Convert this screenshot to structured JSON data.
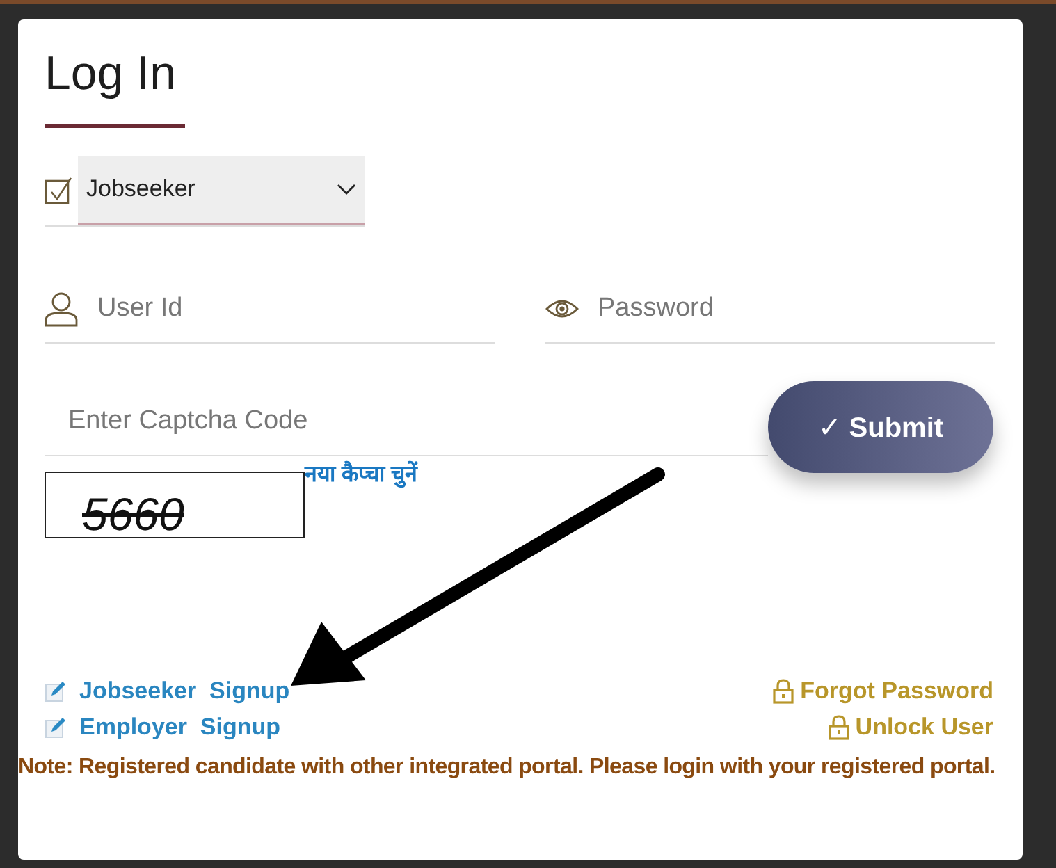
{
  "title": "Log In",
  "user_type": {
    "value": "Jobseeker"
  },
  "fields": [
    {
      "kind": "user",
      "placeholder": "User Id"
    },
    {
      "kind": "password",
      "placeholder": "Password"
    }
  ],
  "captcha": {
    "placeholder": "Enter Captcha Code",
    "code": "5660",
    "refresh_link": "नया कैप्चा चुनें"
  },
  "submit": {
    "label": "✓ Submit"
  },
  "signup_links": [
    "Jobseeker  Signup",
    "Employer  Signup"
  ],
  "account_links": [
    "Forgot Password",
    "Unlock User"
  ],
  "note": "Note: Registered candidate with other integrated portal. Please login with your registered portal."
}
